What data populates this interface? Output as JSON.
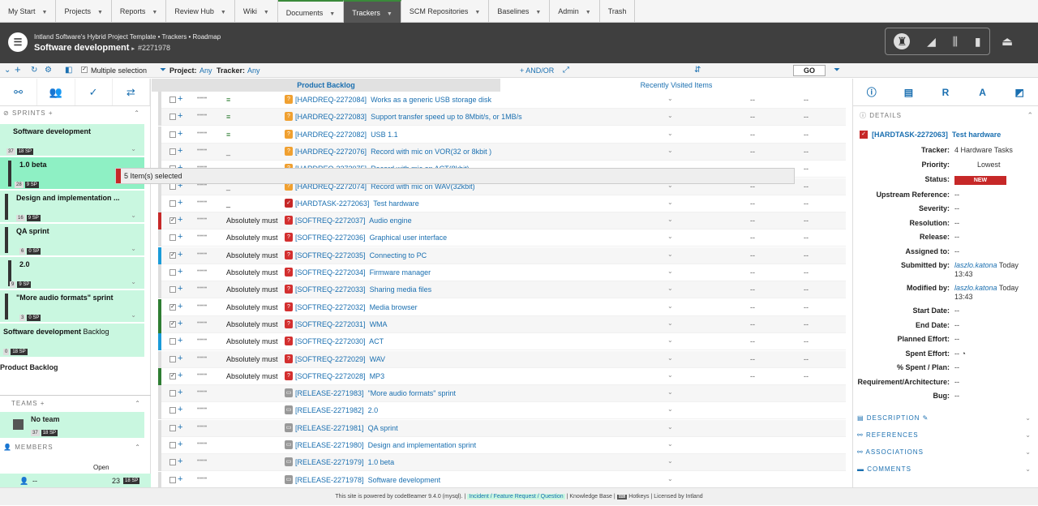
{
  "nav": {
    "tabs": [
      "My Start",
      "Projects",
      "Reports",
      "Review Hub",
      "Wiki",
      "Documents",
      "Trackers",
      "SCM Repositories",
      "Baselines",
      "Admin",
      "Trash"
    ]
  },
  "header": {
    "breadcrumb": "Intland Software's Hybrid Project Template • Trackers • Roadmap",
    "title": "Software development",
    "title_suffix": "▸",
    "id": "#2271978"
  },
  "toolbar": {
    "multiple_selection": "Multiple selection",
    "project_label": "Project:",
    "project_value": "Any",
    "tracker_label": "Tracker:",
    "tracker_value": "Any",
    "and_or": "AND/OR",
    "go": "GO"
  },
  "left": {
    "sprints_header": "SPRINTS",
    "sprints": [
      {
        "name": "Software development",
        "b1": "37",
        "b2": "18 SP"
      },
      {
        "name": "1.0 beta",
        "b1": "28",
        "b2": "9 SP"
      },
      {
        "name": "Design and implementation ...",
        "b1": "16",
        "b2": "9 SP"
      },
      {
        "name": "QA sprint",
        "b1": "6",
        "b2": "0 SP"
      },
      {
        "name": "2.0",
        "b1": "9",
        "b2": "9 SP"
      },
      {
        "name": "\"More audio formats\" sprint",
        "b1": "3",
        "b2": "0 SP"
      },
      {
        "name": "Software development",
        "name2": "Backlog",
        "b1": "0",
        "b2": "18 SP"
      }
    ],
    "product_backlog": "Product Backlog",
    "teams_header": "TEAMS",
    "team": {
      "name": "No team",
      "b1": "37",
      "b2": "18 SP"
    },
    "members_header": "MEMBERS",
    "members_col": "Open",
    "member": {
      "name": "--",
      "count": "23",
      "badge": "18 SP"
    }
  },
  "center": {
    "tab_backlog": "Product Backlog",
    "tab_recent": "Recently Visited Items",
    "selection_tooltip": "5 Item(s) selected",
    "rows": [
      {
        "priority": "",
        "ref": "[HARDREQ-2272084]",
        "title": "Works as a generic USB storage disk",
        "type": "hardreq",
        "c1": "--",
        "c2": "--",
        "dd": "⌄"
      },
      {
        "priority": "",
        "ref": "[HARDREQ-2272083]",
        "title": "Support transfer speed up to 8Mbit/s, or 1MB/s",
        "type": "hardreq",
        "c1": "--",
        "c2": "--",
        "dd": "⌄"
      },
      {
        "priority": "",
        "ref": "[HARDREQ-2272082]",
        "title": "USB 1.1",
        "type": "hardreq",
        "c1": "--",
        "c2": "--",
        "dd": "⌄"
      },
      {
        "priority": "",
        "ref": "[HARDREQ-2272076]",
        "title": "Record with mic on VOR(32 or 8kbit )",
        "type": "hardreq",
        "c1": "--",
        "c2": "--",
        "dd": "⌄"
      },
      {
        "priority": "",
        "ref": "[HARDREQ-2272075]",
        "title": "Record with mic on ACT(8kbit)",
        "type": "hardreq",
        "c1": "--",
        "c2": "--",
        "dd": "⌄"
      },
      {
        "priority": "",
        "ref": "[HARDREQ-2272074]",
        "title": "Record with mic on WAV(32kbit)",
        "type": "hardreq",
        "c1": "--",
        "c2": "--",
        "dd": "⌄"
      },
      {
        "priority": "",
        "ref": "[HARDTASK-2272063]",
        "title": "Test hardware",
        "type": "hardtask",
        "c1": "--",
        "c2": "--",
        "dd": "⌄"
      },
      {
        "priority": "Absolutely must",
        "ref": "[SOFTREQ-2272037]",
        "title": "Audio engine",
        "type": "softreq",
        "c1": "--",
        "c2": "--",
        "dd": "⌄"
      },
      {
        "priority": "Absolutely must",
        "ref": "[SOFTREQ-2272036]",
        "title": "Graphical user interface",
        "type": "softreq",
        "c1": "--",
        "c2": "--",
        "dd": "⌄"
      },
      {
        "priority": "Absolutely must",
        "ref": "[SOFTREQ-2272035]",
        "title": "Connecting to PC",
        "type": "softreq",
        "c1": "--",
        "c2": "--",
        "dd": "⌄"
      },
      {
        "priority": "Absolutely must",
        "ref": "[SOFTREQ-2272034]",
        "title": "Firmware manager",
        "type": "softreq",
        "c1": "--",
        "c2": "--",
        "dd": "⌄"
      },
      {
        "priority": "Absolutely must",
        "ref": "[SOFTREQ-2272033]",
        "title": "Sharing media files",
        "type": "softreq",
        "c1": "--",
        "c2": "--",
        "dd": "⌄"
      },
      {
        "priority": "Absolutely must",
        "ref": "[SOFTREQ-2272032]",
        "title": "Media browser",
        "type": "softreq",
        "c1": "--",
        "c2": "--",
        "dd": "⌄"
      },
      {
        "priority": "Absolutely must",
        "ref": "[SOFTREQ-2272031]",
        "title": "WMA",
        "type": "softreq",
        "c1": "--",
        "c2": "--",
        "dd": "⌄"
      },
      {
        "priority": "Absolutely must",
        "ref": "[SOFTREQ-2272030]",
        "title": "ACT",
        "type": "softreq",
        "c1": "--",
        "c2": "--",
        "dd": "⌄"
      },
      {
        "priority": "Absolutely must",
        "ref": "[SOFTREQ-2272029]",
        "title": "WAV",
        "type": "softreq",
        "c1": "--",
        "c2": "--",
        "dd": "⌄"
      },
      {
        "priority": "Absolutely must",
        "ref": "[SOFTREQ-2272028]",
        "title": "MP3",
        "type": "softreq",
        "c1": "--",
        "c2": "--",
        "dd": "⌄"
      },
      {
        "priority": "",
        "ref": "[RELEASE-2271983]",
        "title": "\"More audio formats\" sprint",
        "type": "release",
        "c1": "",
        "c2": "",
        "dd": "⌄"
      },
      {
        "priority": "",
        "ref": "[RELEASE-2271982]",
        "title": "2.0",
        "type": "release",
        "c1": "",
        "c2": "",
        "dd": "⌄"
      },
      {
        "priority": "",
        "ref": "[RELEASE-2271981]",
        "title": "QA sprint",
        "type": "release",
        "c1": "",
        "c2": "",
        "dd": "⌄"
      },
      {
        "priority": "",
        "ref": "[RELEASE-2271980]",
        "title": "Design and implementation sprint",
        "type": "release",
        "c1": "",
        "c2": "",
        "dd": "⌄"
      },
      {
        "priority": "",
        "ref": "[RELEASE-2271979]",
        "title": "1.0 beta",
        "type": "release",
        "c1": "",
        "c2": "",
        "dd": "⌄"
      },
      {
        "priority": "",
        "ref": "[RELEASE-2271978]",
        "title": "Software development",
        "type": "release",
        "c1": "",
        "c2": "",
        "dd": "⌄"
      }
    ]
  },
  "details": {
    "header": "DETAILS",
    "item_ref": "[HARDTASK-2272063]",
    "item_title": "Test hardware",
    "fields": [
      {
        "label": "Tracker:",
        "value": "4 Hardware Tasks"
      },
      {
        "label": "Priority:",
        "value": "Lowest"
      },
      {
        "label": "Status:",
        "value": "NEW"
      },
      {
        "label": "Upstream Reference:",
        "value": "--"
      },
      {
        "label": "Severity:",
        "value": "--"
      },
      {
        "label": "Resolution:",
        "value": "--"
      },
      {
        "label": "Release:",
        "value": "--"
      },
      {
        "label": "Assigned to:",
        "value": "--"
      },
      {
        "label": "Submitted by:",
        "user": "laszlo.katona",
        "value": "Today 13:43"
      },
      {
        "label": "Modified by:",
        "user": "laszlo.katona",
        "value": "Today 13:43"
      },
      {
        "label": "Start Date:",
        "value": "--"
      },
      {
        "label": "End Date:",
        "value": "--"
      },
      {
        "label": "Planned Effort:",
        "value": "--"
      },
      {
        "label": "Spent Effort:",
        "value": "--"
      },
      {
        "label": "% Spent / Plan:",
        "value": "--"
      },
      {
        "label": "Requirement/Architecture:",
        "value": "--"
      },
      {
        "label": "Bug:",
        "value": "--"
      }
    ],
    "sections": [
      "DESCRIPTION",
      "REFERENCES",
      "ASSOCIATIONS",
      "COMMENTS"
    ]
  },
  "footer": {
    "powered": "This site is powered by codeBeamer 9.4.0 (mysql).",
    "incident": "Incident / Feature Request / Question",
    "kb": "Knowledge Base",
    "hotkeys": "Hotkeys",
    "licensed": "Licensed by Intland"
  },
  "colors": {
    "accent": "#1a6fb0",
    "sprint_bg": "#c9f7e0",
    "status_new": "#c62828",
    "hardreq": "#f0a030",
    "softreq": "#d32f2f",
    "release": "#999999"
  }
}
